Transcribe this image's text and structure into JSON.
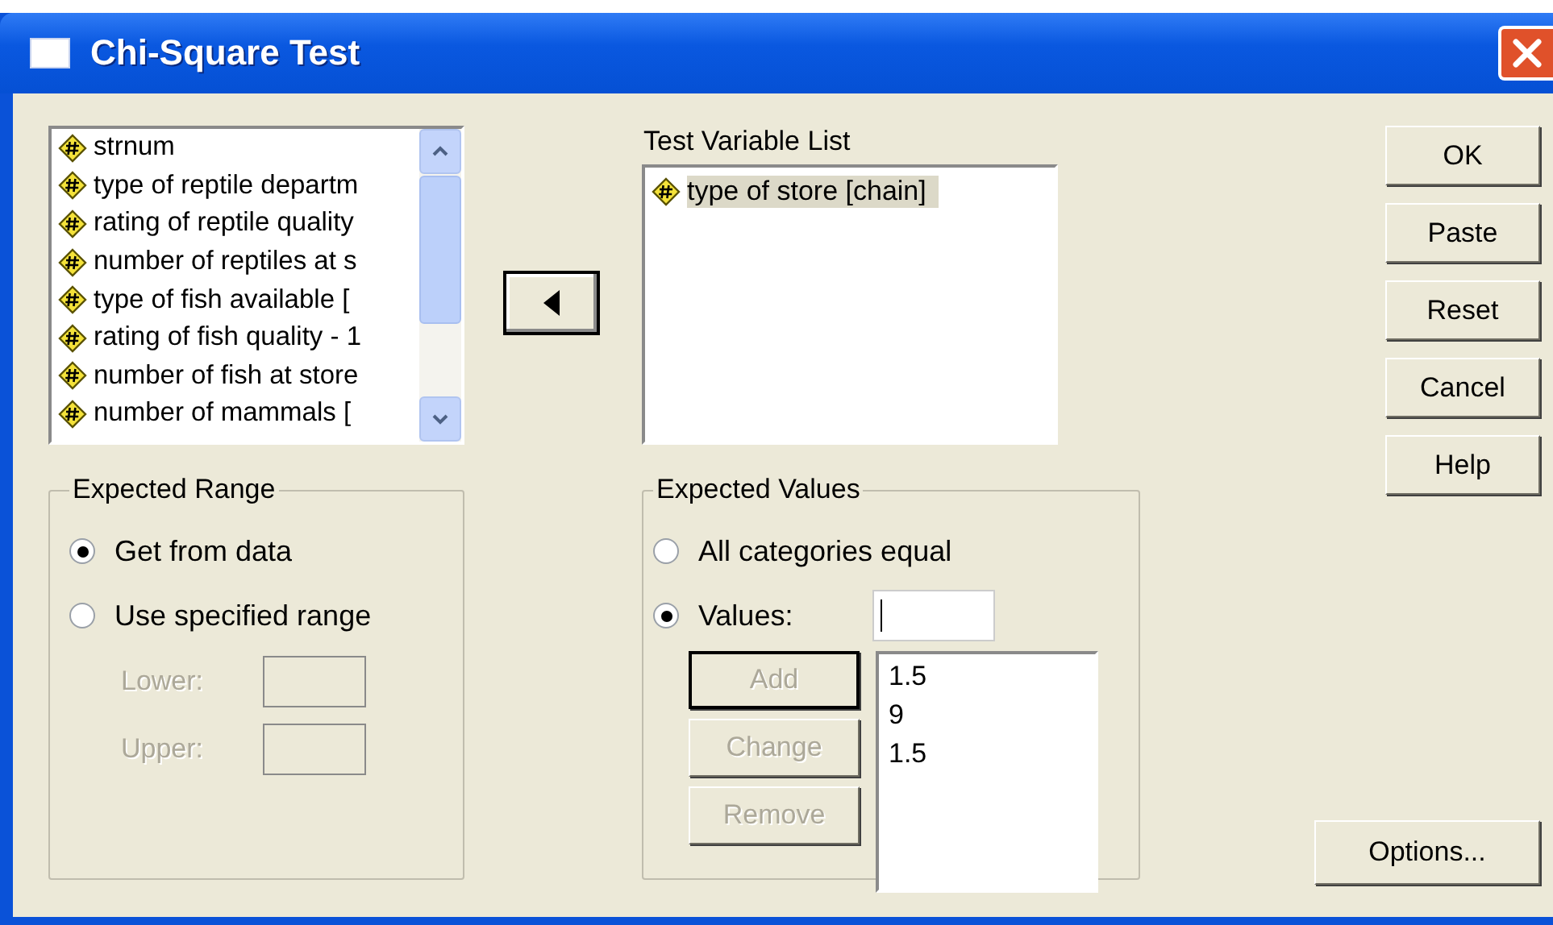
{
  "window": {
    "title": "Chi-Square Test"
  },
  "source_list": {
    "items": [
      {
        "text": "strnum"
      },
      {
        "text": "type of reptile departm"
      },
      {
        "text": "rating of reptile quality"
      },
      {
        "text": "number of reptiles at s"
      },
      {
        "text": "type of fish available ["
      },
      {
        "text": "rating of fish quality - 1"
      },
      {
        "text": "number of fish at store"
      },
      {
        "text": "number of mammals ["
      }
    ]
  },
  "test_variable_list": {
    "label": "Test Variable List",
    "items": [
      {
        "text": "type of store [chain]",
        "selected": true
      }
    ]
  },
  "buttons": [
    {
      "label": "OK"
    },
    {
      "label": "Paste"
    },
    {
      "label": "Reset"
    },
    {
      "label": "Cancel"
    },
    {
      "label": "Help"
    }
  ],
  "expected_range": {
    "title": "Expected Range",
    "options": [
      {
        "label": "Get from data",
        "selected": true
      },
      {
        "label": "Use specified range",
        "selected": false
      }
    ],
    "fields": [
      {
        "label": "Lower:",
        "disabled": true
      },
      {
        "label": "Upper:",
        "disabled": true
      }
    ]
  },
  "expected_values": {
    "title": "Expected Values",
    "options": [
      {
        "label": "All categories equal",
        "selected": false
      },
      {
        "label": "Values:",
        "selected": true
      }
    ],
    "buttons": [
      {
        "label": "Add",
        "disabled": true,
        "default": true
      },
      {
        "label": "Change",
        "disabled": true,
        "default": false
      },
      {
        "label": "Remove",
        "disabled": true,
        "default": false
      }
    ],
    "values": [
      "1.5",
      "9",
      "1.5"
    ]
  },
  "options_button": {
    "label": "Options..."
  }
}
